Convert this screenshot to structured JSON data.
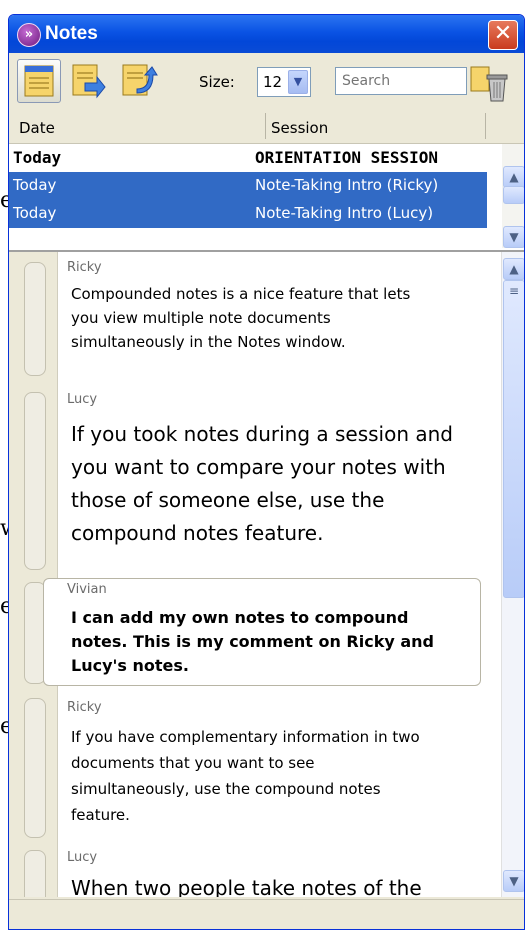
{
  "background_doc": {
    "fragments": [
      "e",
      "w",
      "e",
      "e"
    ]
  },
  "window": {
    "title": "Notes",
    "close_label": "✕"
  },
  "toolbar": {
    "size_label": "Size:",
    "size_value": "12",
    "search_placeholder": "Search",
    "buttons": [
      {
        "name": "notes-view-icon",
        "active": true
      },
      {
        "name": "export-notes-icon",
        "active": false
      },
      {
        "name": "import-notes-icon",
        "active": false
      }
    ]
  },
  "columns": {
    "date": "Date",
    "session": "Session"
  },
  "sessions": [
    {
      "date": "Today",
      "session": "ORIENTATION SESSION",
      "style": "bold"
    },
    {
      "date": "Today",
      "session": "Note-Taking Intro (Ricky)",
      "style": "selected"
    },
    {
      "date": "Today",
      "session": "Note-Taking Intro (Lucy)",
      "style": "selected"
    }
  ],
  "notes": [
    {
      "author": "Ricky",
      "lines": [
        "Compounded notes is a nice feature that lets",
        "you view multiple note documents",
        "simultaneously in the Notes window."
      ]
    },
    {
      "author": "Lucy",
      "lines": [
        "If you took notes during a session and",
        "you want to compare your notes with",
        "those of someone else, use the",
        "compound notes feature."
      ]
    },
    {
      "author": "Vivian",
      "lines": [
        "I can add my own notes to compound",
        "notes. This is my comment on Ricky and",
        "Lucy's notes."
      ]
    },
    {
      "author": "Ricky",
      "lines": [
        "If you have complementary information in two",
        "documents that you want to see",
        "simultaneously, use the compound notes",
        "feature."
      ]
    },
    {
      "author": "Lucy",
      "lines": [
        "When two people take notes of the"
      ]
    }
  ],
  "colors": {
    "titlebar": "#0A53E4",
    "selection": "#316AC5",
    "chrome": "#ECE9D8"
  }
}
